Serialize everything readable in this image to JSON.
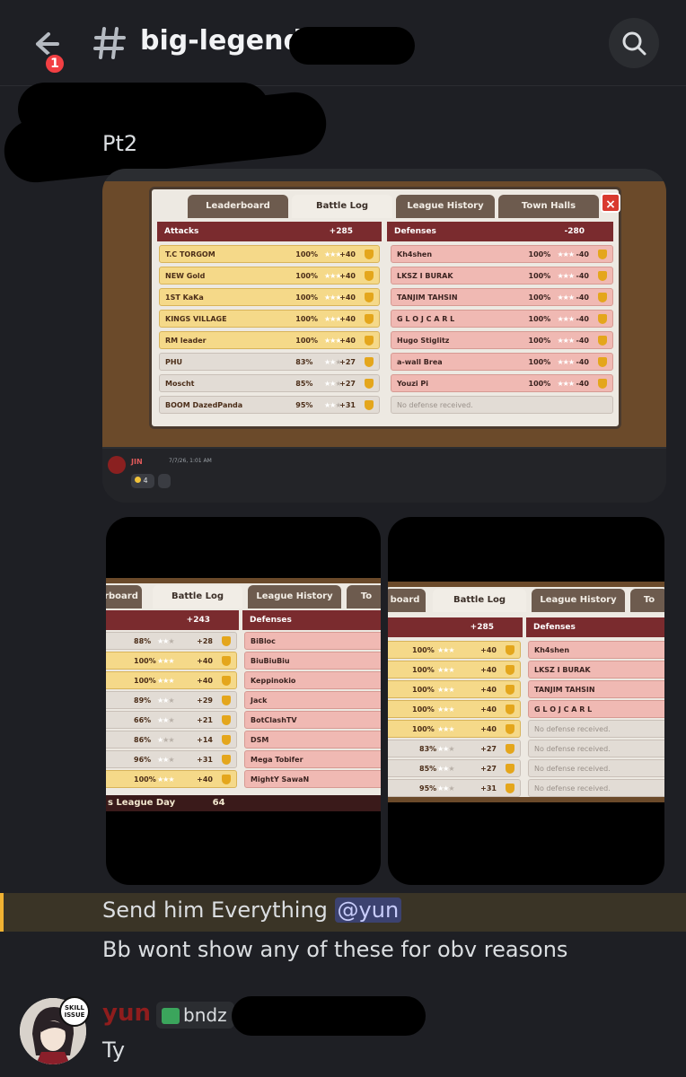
{
  "header": {
    "channel_name": "big-legends",
    "unread_count": "1"
  },
  "messages": {
    "first_text": "Pt2",
    "highlight_prefix": "Send him Everything ",
    "highlight_mention": "@yun",
    "second_text": "Bb wont show any of these for obv reasons",
    "reply_user": "yun",
    "reply_tag": "bndz",
    "reply_text": "Ty"
  },
  "embed1": {
    "tabs": [
      "Leaderboard",
      "Battle Log",
      "League History",
      "Town Halls"
    ],
    "attacks_label": "Attacks",
    "attacks_total": "+285",
    "defenses_label": "Defenses",
    "defenses_total": "-280",
    "attacks": [
      {
        "name": "T.C TORGOM",
        "pct": "100%",
        "score": "+40"
      },
      {
        "name": "NEW Gold",
        "pct": "100%",
        "score": "+40"
      },
      {
        "name": "1ST KaKa",
        "pct": "100%",
        "score": "+40"
      },
      {
        "name": "KINGS VILLAGE",
        "pct": "100%",
        "score": "+40"
      },
      {
        "name": "RM leader",
        "pct": "100%",
        "score": "+40"
      },
      {
        "name": "PHU",
        "pct": "83%",
        "score": "+27"
      },
      {
        "name": "Moscht",
        "pct": "85%",
        "score": "+27"
      },
      {
        "name": "BOOM DazedPanda",
        "pct": "95%",
        "score": "+31"
      }
    ],
    "defenses": [
      {
        "name": "Kh4shen",
        "pct": "100%",
        "score": "-40"
      },
      {
        "name": "LKSZ I BURAK",
        "pct": "100%",
        "score": "-40"
      },
      {
        "name": "TANJIM TAHSIN",
        "pct": "100%",
        "score": "-40"
      },
      {
        "name": "G L O J C A R L",
        "pct": "100%",
        "score": "-40"
      },
      {
        "name": "Hugo Stiglitz",
        "pct": "100%",
        "score": "-40"
      },
      {
        "name": "a-wall Brea",
        "pct": "100%",
        "score": "-40"
      },
      {
        "name": "Youzi Pi",
        "pct": "100%",
        "score": "-40"
      },
      {
        "name": "No defense received.",
        "pct": "",
        "score": ""
      }
    ],
    "footer_user": "JIN",
    "footer_date": "7/7/26, 1:01 AM",
    "reaction_count": "4"
  },
  "embed2": {
    "tabs": [
      "rboard",
      "Battle Log",
      "League History",
      "To"
    ],
    "attacks_total": "+243",
    "defenses_label": "Defenses",
    "attacks": [
      {
        "pct": "88%",
        "score": "+28"
      },
      {
        "pct": "100%",
        "score": "+40"
      },
      {
        "pct": "100%",
        "score": "+40"
      },
      {
        "pct": "89%",
        "score": "+29"
      },
      {
        "pct": "66%",
        "score": "+21"
      },
      {
        "pct": "86%",
        "score": "+14"
      },
      {
        "pct": "96%",
        "score": "+31"
      },
      {
        "pct": "100%",
        "score": "+40"
      }
    ],
    "defenses": [
      "BiBloc",
      "BiuBiuBiu",
      "Keppinokio",
      "Jack",
      "BotClashTV",
      "DSM",
      "Mega Tobifer",
      "MightY SawaN"
    ],
    "footer_label": "s League Day",
    "footer_value": "64"
  },
  "embed3": {
    "tabs": [
      "board",
      "Battle Log",
      "League History",
      "To"
    ],
    "attacks_total": "+285",
    "defenses_label": "Defenses",
    "attacks": [
      {
        "pct": "100%",
        "score": "+40"
      },
      {
        "pct": "100%",
        "score": "+40"
      },
      {
        "pct": "100%",
        "score": "+40"
      },
      {
        "pct": "100%",
        "score": "+40"
      },
      {
        "pct": "100%",
        "score": "+40"
      },
      {
        "pct": "83%",
        "score": "+27"
      },
      {
        "pct": "85%",
        "score": "+27"
      },
      {
        "pct": "95%",
        "score": "+31"
      }
    ],
    "defenses": [
      "Kh4shen",
      "LKSZ I BURAK",
      "TANJIM TAHSIN",
      "G L O J C A R L",
      "No defense received.",
      "No defense received.",
      "No defense received.",
      "No defense received."
    ]
  }
}
